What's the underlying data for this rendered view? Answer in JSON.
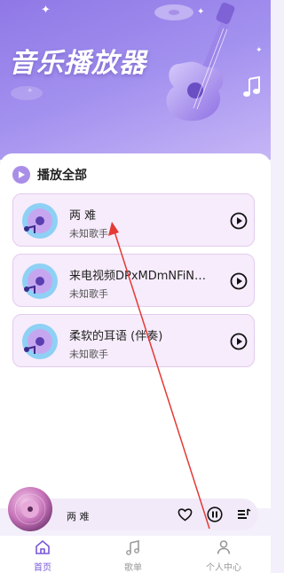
{
  "header": {
    "title": "音乐播放器"
  },
  "section": {
    "play_all_label": "播放全部"
  },
  "songs": [
    {
      "title": "两 难",
      "artist": "未知歌手"
    },
    {
      "title": "来电视频DPxMDmNFiN…",
      "artist": "未知歌手"
    },
    {
      "title": "柔软的耳语 (伴奏)",
      "artist": "未知歌手"
    }
  ],
  "player": {
    "now_playing_title": "两 难"
  },
  "tabs": [
    {
      "label": "首页",
      "icon": "home-icon",
      "active": true
    },
    {
      "label": "歌单",
      "icon": "music-note-icon",
      "active": false
    },
    {
      "label": "个人中心",
      "icon": "user-icon",
      "active": false
    }
  ],
  "colors": {
    "accent": "#7a58d6",
    "card_bg": "#f6ecfb",
    "card_border": "#e4cbef",
    "annotation_arrow": "#e53935"
  }
}
